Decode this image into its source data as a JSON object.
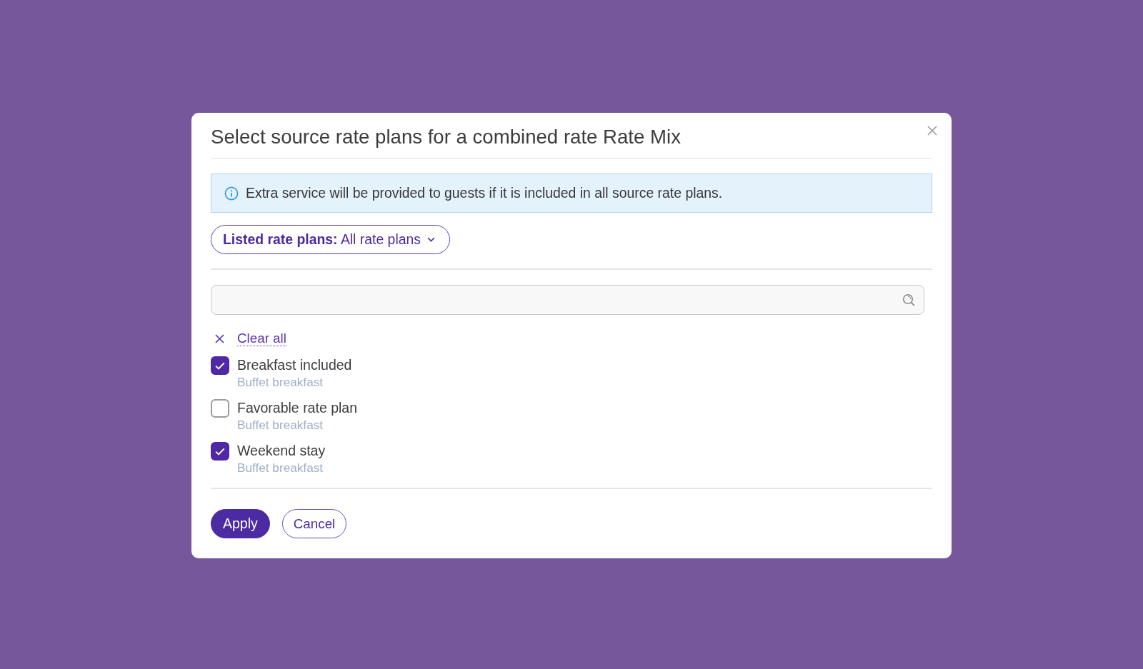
{
  "dialog": {
    "title": "Select source rate plans for a combined rate Rate Mix",
    "info_banner": {
      "text": "Extra service will be provided to guests if it is included in all source rate plans."
    },
    "filter": {
      "label": "**Listed rate plans:** All rate plans"
    },
    "clear_all": "Clear all",
    "rate_plans": [
      {
        "name": "Breakfast included",
        "description": "Buffet breakfast",
        "checked": true
      },
      {
        "name": "Favorable rate plan",
        "description": "Buffet breakfast",
        "checked": false
      },
      {
        "name": "Weekend stay",
        "description": "Buffet breakfast",
        "checked": true
      }
    ],
    "buttons": [
      {
        "label": "Apply",
        "kind": "primary"
      },
      {
        "label": "Cancel",
        "kind": "secondary"
      }
    ]
  }
}
